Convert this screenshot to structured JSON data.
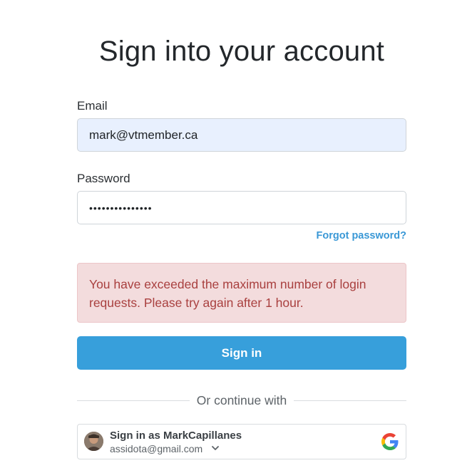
{
  "page": {
    "title": "Sign into your account"
  },
  "form": {
    "email_label": "Email",
    "email_value": "mark@vtmember.ca",
    "password_label": "Password",
    "password_value": "•••••••••••••••",
    "forgot_label": "Forgot password?",
    "error_message": "You have exceeded the maximum number of login requests. Please try again after 1 hour.",
    "signin_label": "Sign in"
  },
  "divider": {
    "text": "Or continue with"
  },
  "google": {
    "account_label": "Sign in as MarkCapillanes",
    "account_email": "assidota@gmail.com",
    "icon": "google-g-icon"
  },
  "colors": {
    "primary": "#379fdb",
    "link": "#3a98d6",
    "error_bg": "#f3dcdd",
    "error_text": "#a9403f",
    "autofill_bg": "#e8f0fe"
  }
}
